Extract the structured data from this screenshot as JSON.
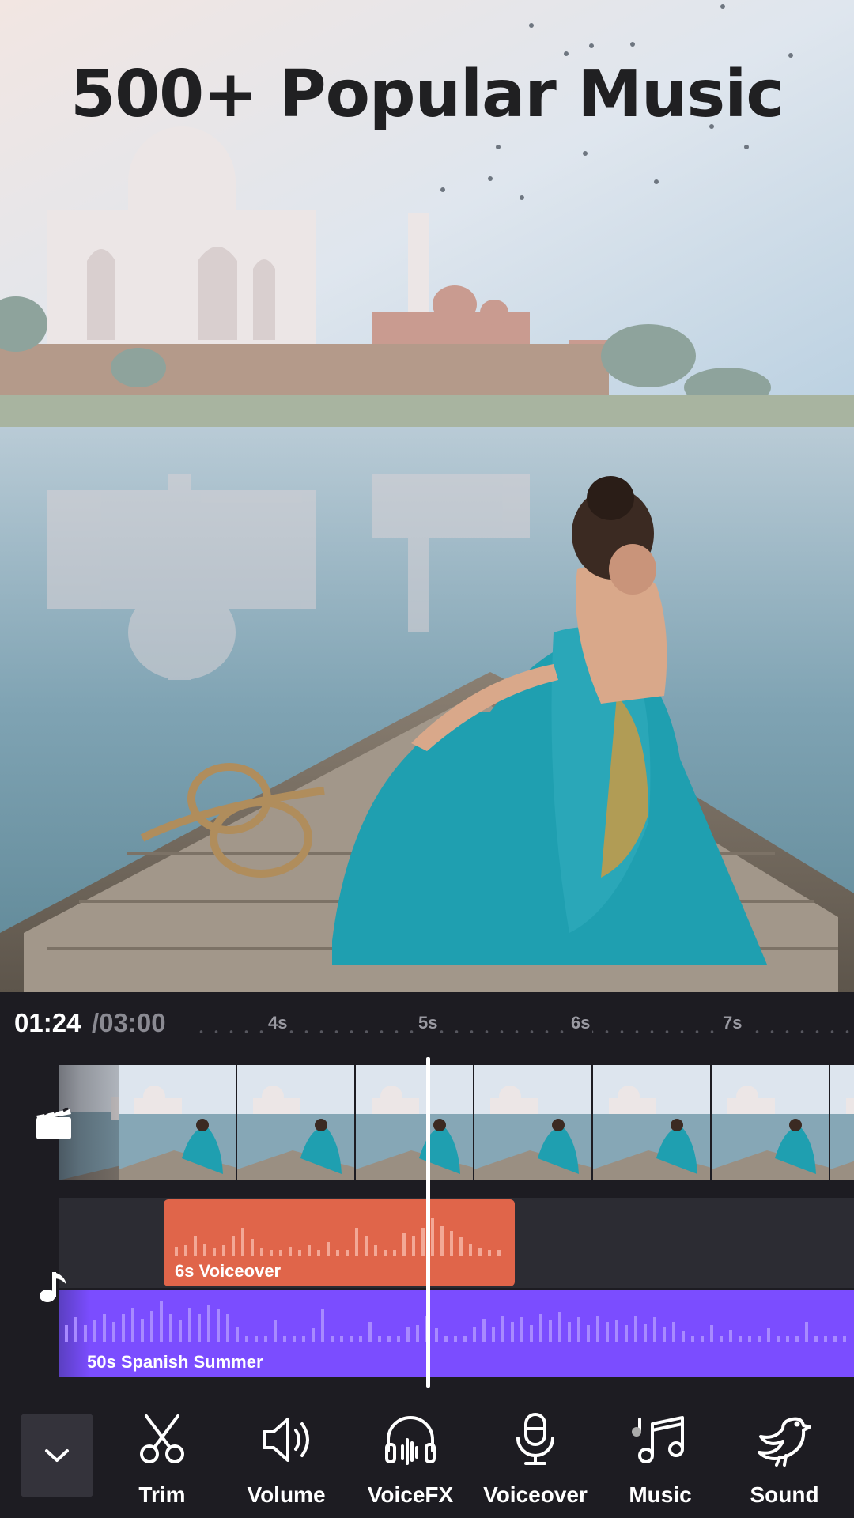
{
  "headline": "500+ Popular Music",
  "timeline": {
    "current_time": "01:24",
    "total_time": "/03:00",
    "ticks": [
      "4s",
      "5s",
      "6s",
      "7s"
    ],
    "voice_clip_label": "6s Voiceover",
    "music_clip_label": "50s Spanish Summer"
  },
  "toolbar": {
    "tools": [
      {
        "label": "Trim",
        "icon": "scissors-icon"
      },
      {
        "label": "Volume",
        "icon": "speaker-icon"
      },
      {
        "label": "VoiceFX",
        "icon": "headphones-icon"
      },
      {
        "label": "Voiceover",
        "icon": "microphone-icon"
      },
      {
        "label": "Music",
        "icon": "music-note-icon"
      },
      {
        "label": "Sound",
        "icon": "bird-icon"
      }
    ]
  },
  "colors": {
    "voice_clip": "#e0654a",
    "music_clip": "#7b4dff",
    "background": "#1d1c22"
  }
}
